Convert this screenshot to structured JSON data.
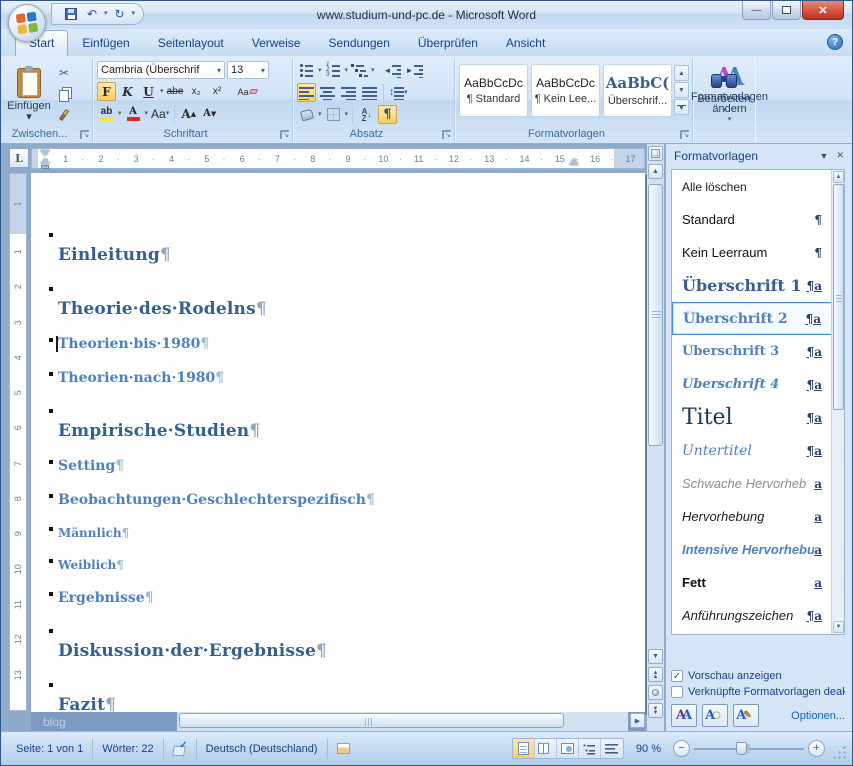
{
  "window": {
    "title": "www.studium-und-pc.de - Microsoft Word"
  },
  "icons": {
    "dropdown": "▾",
    "dropdown_big": "▼",
    "close": "✕",
    "minimize": "—",
    "scissors": "✂",
    "undo": "↶",
    "redo": "↻",
    "pilcrow": "¶",
    "help": "?",
    "up": "▲",
    "down": "▼",
    "right": "▶",
    "check": "✓",
    "pencil": "✎",
    "updown": "↕",
    "out_arrow": "◄",
    "in_arrow": "►",
    "sort_down": "↓",
    "sort_a": "A",
    "sort_z": "Z",
    "magnifier": "○"
  },
  "tabs": [
    "Start",
    "Einfügen",
    "Seitenlayout",
    "Verweise",
    "Sendungen",
    "Überprüfen",
    "Ansicht"
  ],
  "ribbon": {
    "clipboard": {
      "label": "Zwischen...",
      "paste": "Einfügen"
    },
    "font": {
      "label": "Schriftart",
      "name": "Cambria (Überschrif",
      "size": "13",
      "bold": "F",
      "italic": "K",
      "underline": "U",
      "strike": "abe",
      "sub": "x₂",
      "sup": "x²",
      "clear": "Aa",
      "highlight": "ab",
      "color": "A",
      "case": "Aa",
      "grow": "A",
      "shrink": "A"
    },
    "paragraph": {
      "label": "Absatz"
    },
    "styles": {
      "label": "Formatvorlagen",
      "change": "Formatvorlagen ändern",
      "tiles": [
        {
          "preview": "AaBbCcDc",
          "name": "¶ Standard"
        },
        {
          "preview": "AaBbCcDc",
          "name": "¶ Kein Lee..."
        },
        {
          "preview": "AaBbC(",
          "name": "Überschrif..."
        }
      ]
    },
    "editing": {
      "label": "Bearbeiten"
    }
  },
  "ruler": {
    "tab_selector": "L",
    "h_numbers": [
      "1",
      "2",
      "3",
      "4",
      "5",
      "6",
      "7",
      "8",
      "9",
      "10",
      "11",
      "12",
      "13",
      "14",
      "15",
      "16",
      "17"
    ],
    "v_margin_number": "1",
    "v_numbers": [
      "1",
      "2",
      "3",
      "4",
      "5",
      "6",
      "7",
      "8",
      "9",
      "10",
      "11",
      "12",
      "13"
    ]
  },
  "document": {
    "watermark": "blog",
    "headings": [
      {
        "level": 1,
        "text": "Einleitung"
      },
      {
        "level": 1,
        "text": "Theorie·des·Rodelns"
      },
      {
        "level": 2,
        "text": "Theorien·bis·1980"
      },
      {
        "level": 2,
        "text": "Theorien·nach·1980"
      },
      {
        "level": 1,
        "text": "Empirische·Studien"
      },
      {
        "level": 2,
        "text": "Setting"
      },
      {
        "level": 2,
        "text": "Beobachtungen·Geschlechterspezifisch"
      },
      {
        "level": 3,
        "text": "Männlich"
      },
      {
        "level": 3,
        "text": "Weiblich"
      },
      {
        "level": 2,
        "text": "Ergebnisse"
      },
      {
        "level": 1,
        "text": "Diskussion·der·Ergebnisse"
      },
      {
        "level": 1,
        "text": "Fazit"
      }
    ]
  },
  "styles_pane": {
    "title": "Formatvorlagen",
    "clear_all": "Alle löschen",
    "items": [
      {
        "name": "Standard",
        "badge": "¶"
      },
      {
        "name": "Kein Leerraum",
        "badge": "¶"
      },
      {
        "name": "Überschrift 1",
        "badge": "¶a"
      },
      {
        "name": "Überschrift 2",
        "badge": "¶a",
        "selected": true
      },
      {
        "name": "Überschrift 3",
        "badge": "¶a"
      },
      {
        "name": "Überschrift 4",
        "badge": "¶a"
      },
      {
        "name": "Titel",
        "badge": "¶a"
      },
      {
        "name": "Untertitel",
        "badge": "¶a"
      },
      {
        "name": "Schwache Hervorheb",
        "badge": "a"
      },
      {
        "name": "Hervorhebung",
        "badge": "a"
      },
      {
        "name": "Intensive Hervorhebu",
        "badge": "a"
      },
      {
        "name": "Fett",
        "badge": "a"
      },
      {
        "name": "Anführungszeichen",
        "badge": "¶a"
      }
    ],
    "preview_label": "Vorschau anzeigen",
    "linked_label": "Verknüpfte Formatvorlagen deak",
    "options": "Optionen..."
  },
  "status": {
    "page": "Seite: 1 von 1",
    "words": "Wörter: 22",
    "language": "Deutsch (Deutschland)",
    "zoom": "90 %"
  }
}
